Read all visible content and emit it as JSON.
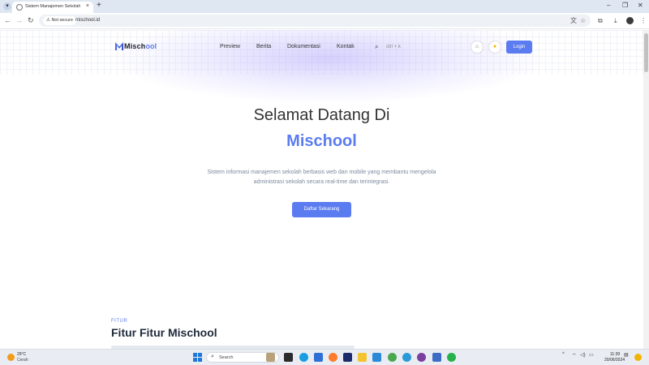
{
  "browser": {
    "tab_title": "Sistem Manajemen Sekolah - Mi",
    "tab_close": "×",
    "new_tab": "+",
    "win_min": "–",
    "win_max": "❐",
    "win_close": "✕",
    "back": "←",
    "forward": "→",
    "reload": "↻",
    "not_secure": "⚠ Not secure",
    "url": "mischool.id"
  },
  "header": {
    "logo_text": "Misch",
    "logo_suffix": "ool",
    "nav": [
      "Preview",
      "Berita",
      "Dokumentasi",
      "Kontak"
    ],
    "search_hint": "ctrl + k",
    "login_label": "Login"
  },
  "hero": {
    "title": "Selamat Datang Di",
    "brand": "Mischool",
    "description": "Sistem informasi manajemen sekolah berbasis web dan mobile yang membantu mengelola administrasi sekolah secara real-time dan terintegrasi.",
    "cta_label": "Daftar Sekarang"
  },
  "fitur": {
    "tag": "FITUR",
    "title": "Fitur Fitur Mischool"
  },
  "taskbar": {
    "weather_temp": "29°C",
    "weather_cond": "Cerah",
    "search_label": "Search",
    "tray_caret": "^",
    "clock_time": "11:39",
    "clock_date": "20/06/2024"
  },
  "colors": {
    "accent": "#5b7cf0",
    "heading": "#333333",
    "muted": "#7a8a9e"
  },
  "icons": {
    "search": "search-icon",
    "language": "translate-icon",
    "theme": "sun-icon"
  }
}
